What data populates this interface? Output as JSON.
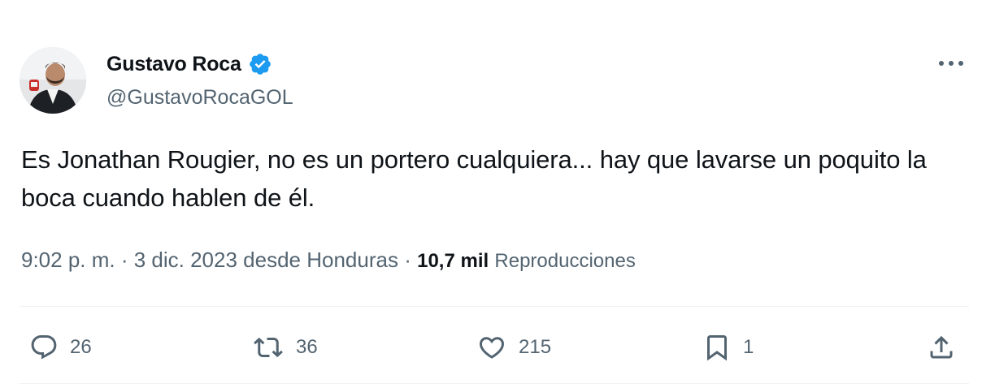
{
  "tweet": {
    "display_name": "Gustavo Roca",
    "handle": "@GustavoRocaGOL",
    "text": "Es Jonathan Rougier, no es un portero cualquiera... hay que lavarse un poquito la boca cuando hablen de él.",
    "timestamp": "9:02 p. m. · 3 dic. 2023 desde Honduras",
    "separator": "·",
    "views_count": "10,7 mil",
    "views_label": "Reproducciones"
  },
  "actions": {
    "replies": "26",
    "retweets": "36",
    "likes": "215",
    "bookmarks": "1"
  },
  "icons": {
    "verified": "verified-badge-icon",
    "more": "more-options-icon",
    "reply": "reply-icon",
    "retweet": "retweet-icon",
    "like": "heart-icon",
    "bookmark": "bookmark-icon",
    "share": "share-icon"
  },
  "colors": {
    "text_primary": "#0f1419",
    "text_secondary": "#536471",
    "verified_blue": "#1d9bf0",
    "divider": "#eff3f4"
  }
}
